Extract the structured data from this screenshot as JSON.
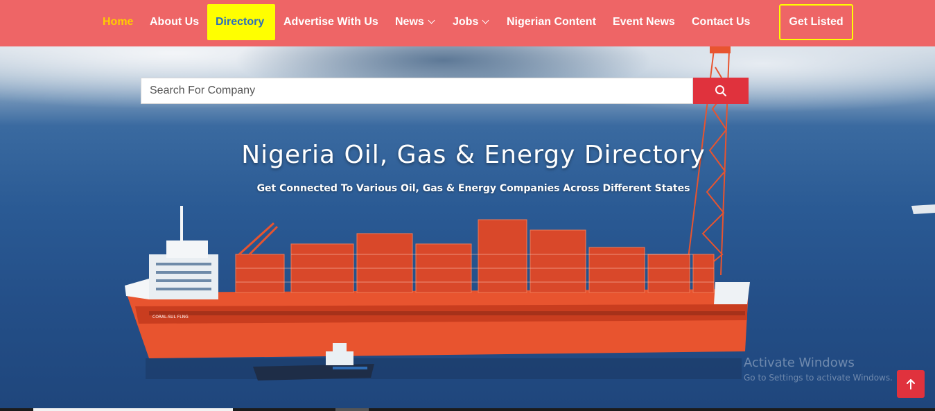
{
  "nav": {
    "home": "Home",
    "about": "About Us",
    "directory": "Directory",
    "advertise": "Advertise With Us",
    "news": "News",
    "jobs": "Jobs",
    "nigerian_content": "Nigerian Content",
    "event_news": "Event News",
    "contact": "Contact Us",
    "get_listed": "Get Listed"
  },
  "search": {
    "placeholder": "Search For Company"
  },
  "hero": {
    "title": "Nigeria Oil, Gas & Energy Directory",
    "subtitle": "Get Connected To Various Oil, Gas & Energy Companies Across Different States"
  },
  "vessel_label": "CORAL-SUL FLNG",
  "windows_watermark": {
    "title": "Activate Windows",
    "subtitle": "Go to Settings to activate Windows."
  },
  "colors": {
    "navbar": "#ee6566",
    "home_active": "#ffcc00",
    "directory_bg": "#ffff00",
    "directory_text": "#2a6ebb",
    "search_button": "#e0323d",
    "back_to_top": "#e0323d"
  },
  "icons": {
    "search": "search-icon",
    "dropdown": "chevron-down-icon",
    "back_to_top": "arrow-up-icon"
  }
}
